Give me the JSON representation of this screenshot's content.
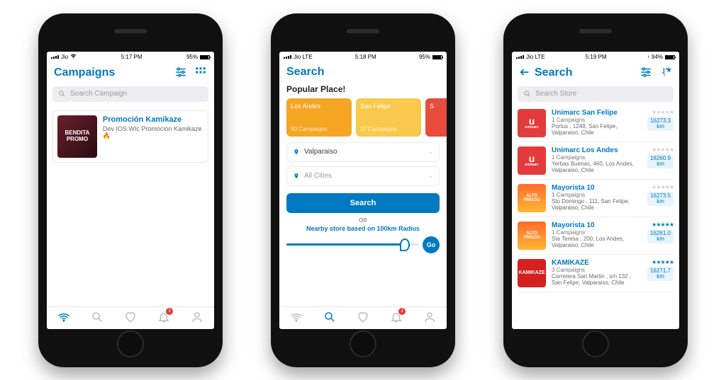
{
  "phone1": {
    "status": {
      "carrier": "Jio",
      "time": "5:17 PM",
      "battery": "95%"
    },
    "title": "Campaigns",
    "search_placeholder": "Search Campaign",
    "card": {
      "thumb": "BENDITA PROMO",
      "title": "Promoción Kamikaze",
      "sub": "Dev IOS WIc Promoción Kamikaze 🔥"
    },
    "badge": "1"
  },
  "phone2": {
    "status": {
      "carrier": "Jio  LTE",
      "time": "5:18 PM",
      "battery": "95%"
    },
    "title": "Search",
    "subtitle": "Popular Place!",
    "places": [
      {
        "name": "Los Andes",
        "count": "90 Campaigns",
        "color": "#f5a623"
      },
      {
        "name": "San Felipe",
        "count": "27 Campaigns",
        "color": "#f8c94a"
      },
      {
        "name": "S",
        "count": "",
        "color": "#e74c3c"
      }
    ],
    "field1": "Valparaiso",
    "field2": "All Cities",
    "search_btn": "Search",
    "or": "OR",
    "nearby": "Nearby store based on 100km Radius",
    "go": "Go",
    "badge": "1"
  },
  "phone3": {
    "status": {
      "carrier": "Jio  LTE",
      "time": "5:19 PM",
      "battery": "94%",
      "battery_icon": "↑ 94%"
    },
    "title": "Search",
    "search_placeholder": "Search Store",
    "stores": [
      {
        "thumb_style": "u",
        "thumb_text": "u",
        "thumb_label": "unimarc",
        "title": "Unimarc San Felipe",
        "sub": "1 Campaigns",
        "addr": "Portus , 1248, San Felipe, Valparaiso, Chile",
        "dist": "16273.3 km",
        "rated": false
      },
      {
        "thumb_style": "u",
        "thumb_text": "u",
        "thumb_label": "unimarc",
        "title": "Unimarc  Los Andes",
        "sub": "1 Campaigns",
        "addr": "Yerbas Buenas, 460, Los Andes, Valparaiso, Chile",
        "dist": "16260.9 km",
        "rated": false
      },
      {
        "thumb_style": "m",
        "thumb_text": "ALTO PRECIO",
        "title": " Mayorista 10",
        "sub": "1 Campaigns",
        "addr": " Sto Domingo , 111, San Felipe, Valparaiso, Chile",
        "dist": "16273.5 km",
        "rated": false
      },
      {
        "thumb_style": "m",
        "thumb_text": "ALTO PRECIO",
        "title": "Mayorista 10",
        "sub": "1 Campaigns",
        "addr": "Sta Teresa , 200, Los Andes, Valparaiso, Chile",
        "dist": "16261.0 km",
        "rated": true
      },
      {
        "thumb_style": "k",
        "thumb_text": "KAMIKAZE",
        "title": "KAMIKAZE",
        "sub": "3 Campaigns",
        "addr": "Carretera San Martin , s/n 132 , San Felipe, Valparaiso, Chile",
        "dist": "16271.7 km",
        "rated": true
      }
    ]
  }
}
